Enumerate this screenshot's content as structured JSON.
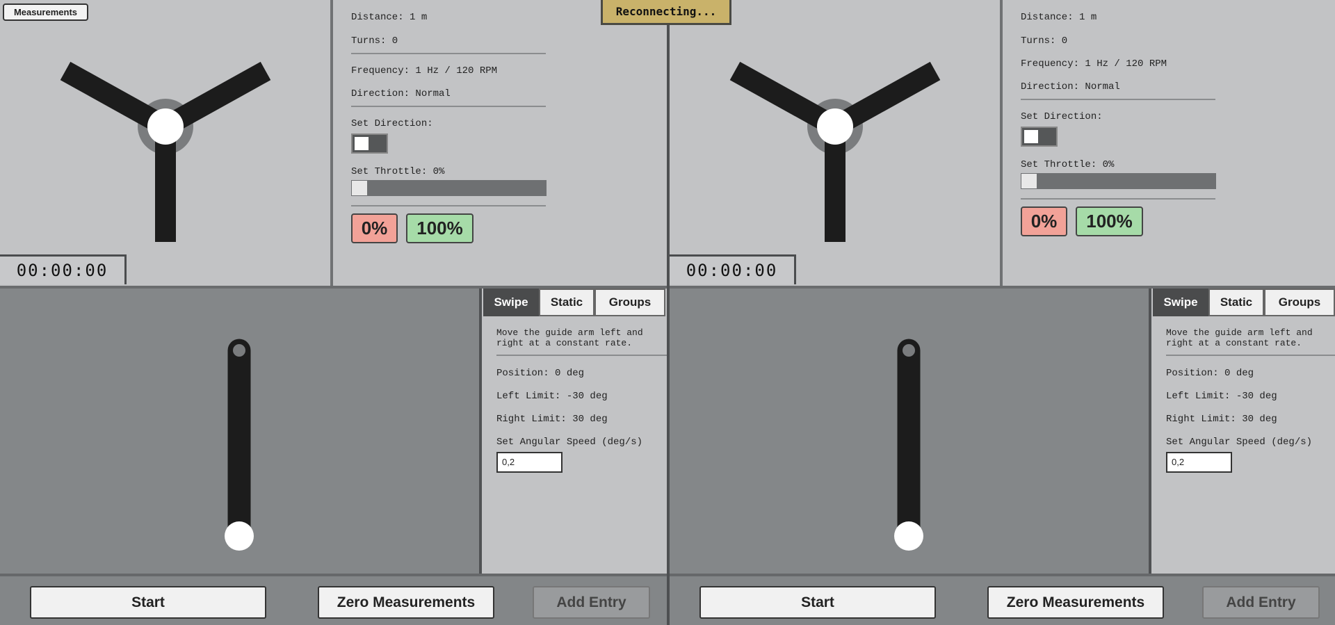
{
  "status_banner": "Reconnecting...",
  "measurements_button": "Measurements",
  "panels": [
    {
      "timer": "00:00:00",
      "distance": "Distance: 1 m",
      "turns": "Turns: 0",
      "frequency": "Frequency: 1 Hz / 120 RPM",
      "direction": "Direction: Normal",
      "set_direction_label": "Set Direction:",
      "set_throttle_label": "Set Throttle: 0%",
      "throttle_level": 0,
      "btn_0": "0%",
      "btn_100": "100%",
      "tabs": [
        "Swipe",
        "Static",
        "Groups"
      ],
      "active_tab": "Swipe",
      "description": "Move the guide arm left and right at a constant rate.",
      "position": "Position: 0 deg",
      "left_limit": "Left Limit: -30 deg",
      "right_limit": "Right Limit: 30 deg",
      "angular_speed_label": "Set Angular Speed (deg/s)",
      "angular_speed_value": "0,2",
      "start": "Start",
      "zero": "Zero Measurements",
      "add_entry": "Add Entry"
    },
    {
      "timer": "00:00:00",
      "distance": "Distance: 1 m",
      "turns": "Turns: 0",
      "frequency": "Frequency: 1 Hz / 120 RPM",
      "direction": "Direction: Normal",
      "set_direction_label": "Set Direction:",
      "set_throttle_label": "Set Throttle: 0%",
      "throttle_level": 0,
      "btn_0": "0%",
      "btn_100": "100%",
      "tabs": [
        "Swipe",
        "Static",
        "Groups"
      ],
      "active_tab": "Swipe",
      "description": "Move the guide arm left and right at a constant rate.",
      "position": "Position: 0 deg",
      "left_limit": "Left Limit: -30 deg",
      "right_limit": "Right Limit: 30 deg",
      "angular_speed_label": "Set Angular Speed (deg/s)",
      "angular_speed_value": "0,2",
      "start": "Start",
      "zero": "Zero Measurements",
      "add_entry": "Add Entry"
    }
  ],
  "colors": {
    "panel_bg": "#c2c3c5",
    "arm_bg": "#848789",
    "btn_zero": "#f2a298",
    "btn_hundred": "#a6dba8",
    "banner": "#c9b26a",
    "active_tab": "#4a4b4c"
  }
}
